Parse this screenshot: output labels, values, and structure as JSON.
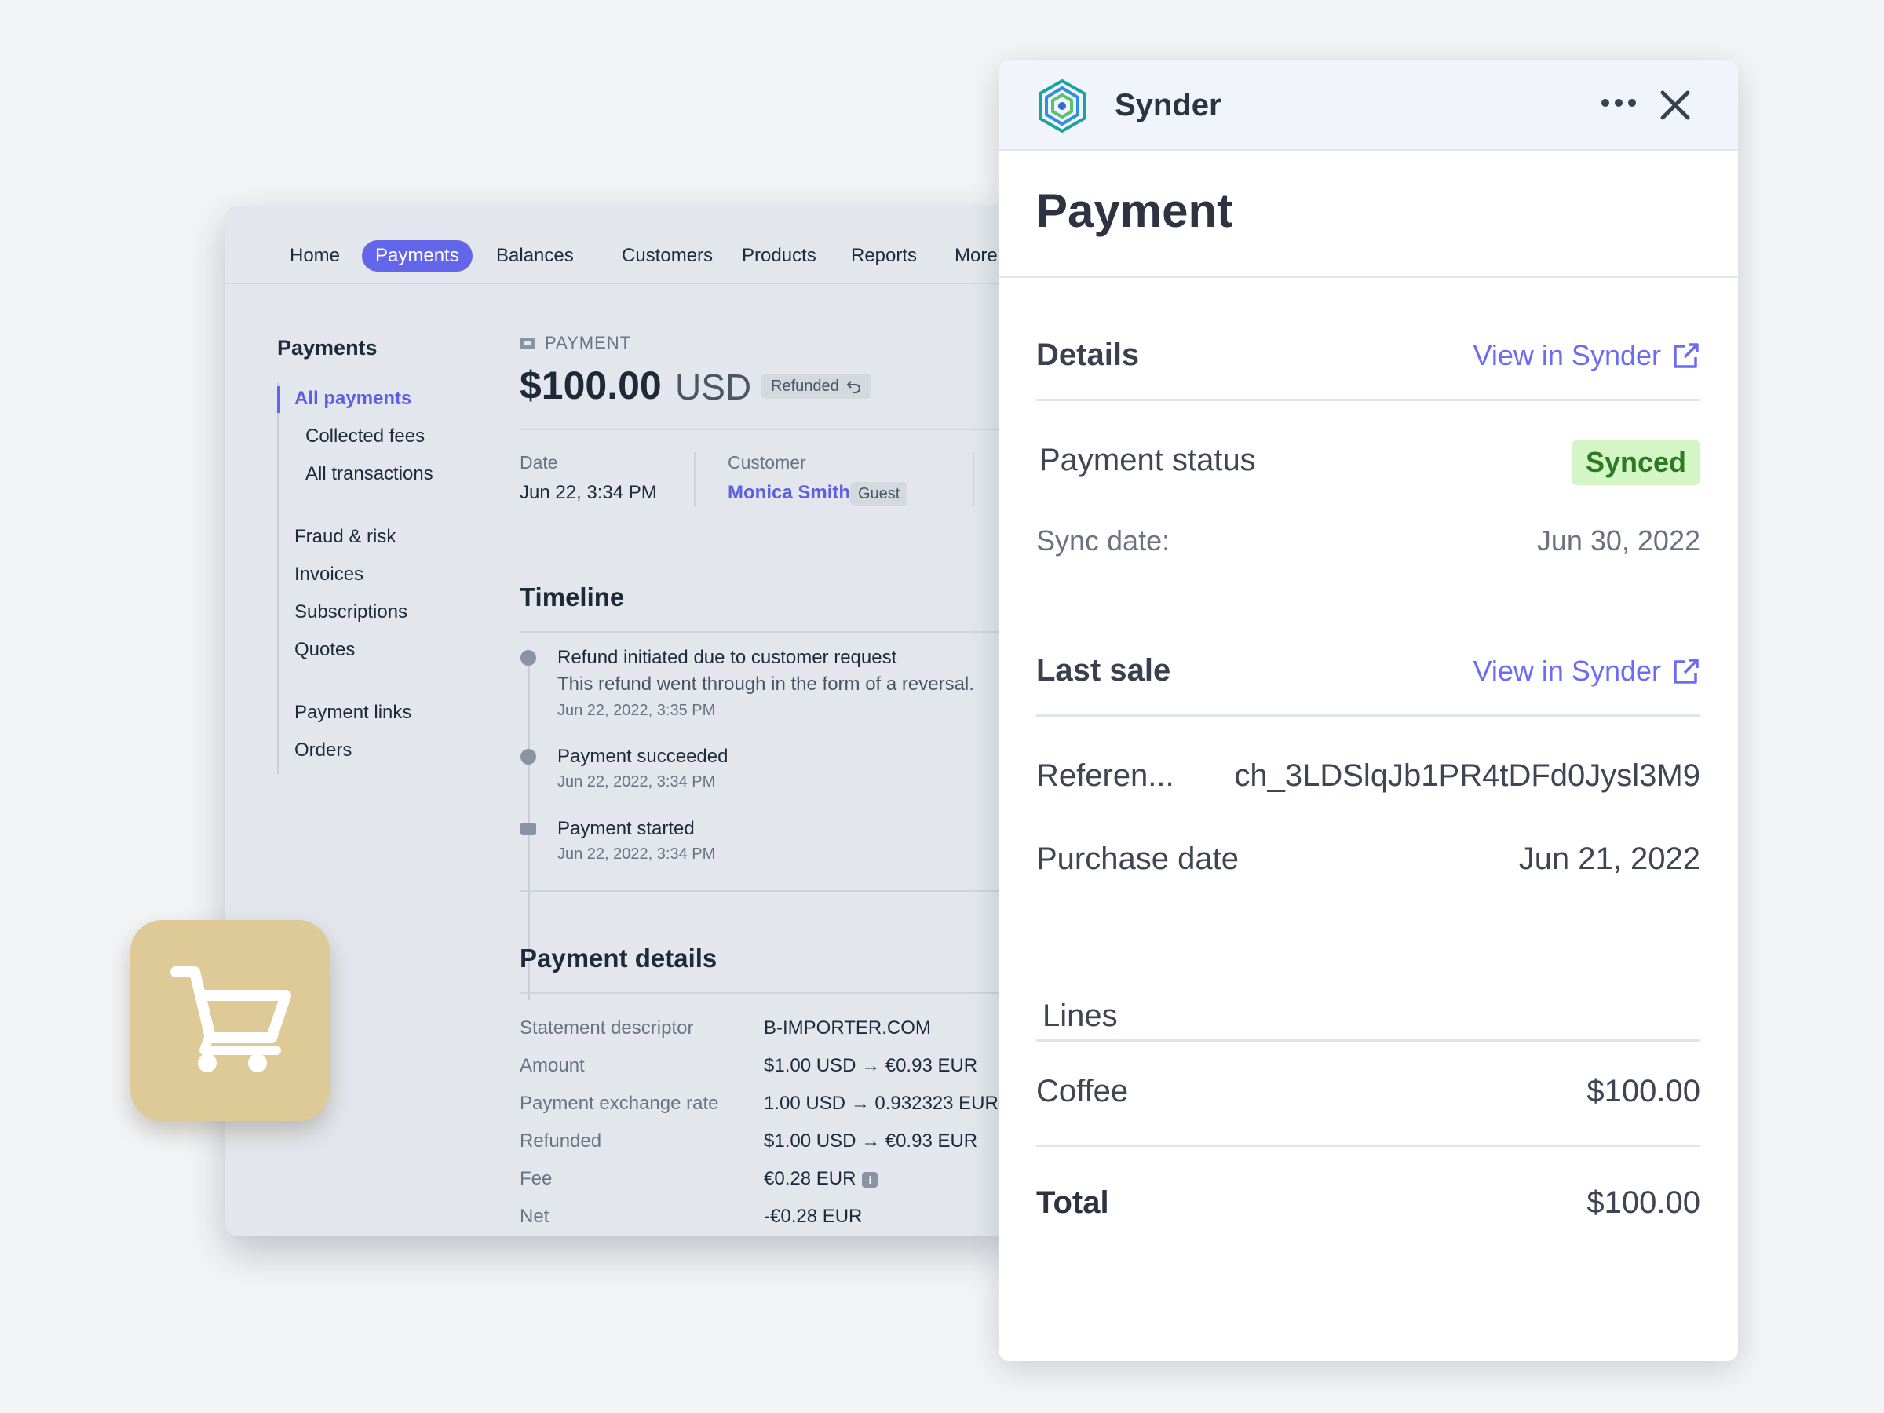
{
  "dashboard": {
    "nav": [
      "Home",
      "Payments",
      "Balances",
      "Customers",
      "Products",
      "Reports",
      "More"
    ],
    "nav_active": "Payments",
    "sidebar": {
      "title": "Payments",
      "items": [
        "All payments",
        "Collected fees",
        "All transactions",
        "Fraud & risk",
        "Invoices",
        "Subscriptions",
        "Quotes",
        "Payment links",
        "Orders"
      ]
    },
    "payment": {
      "label": "PAYMENT",
      "amount": "$100.00",
      "currency": "USD",
      "status_badge": "Refunded",
      "date_label": "Date",
      "date_value": "Jun 22, 3:34 PM",
      "customer_label": "Customer",
      "customer_name": "Monica Smith",
      "customer_badge": "Guest"
    },
    "timeline": {
      "title": "Timeline",
      "events": [
        {
          "title": "Refund initiated due to customer request",
          "subtitle": "This refund went through in the form of a reversal.",
          "time": "Jun 22, 2022, 3:35 PM"
        },
        {
          "title": "Payment succeeded",
          "time": "Jun 22, 2022, 3:34 PM"
        },
        {
          "title": "Payment started",
          "time": "Jun 22, 2022, 3:34 PM"
        }
      ]
    },
    "details": {
      "title": "Payment details",
      "rows": [
        {
          "label": "Statement descriptor",
          "value": "B-IMPORTER.COM"
        },
        {
          "label": "Amount",
          "value": "$1.00 USD  →  €0.93 EUR"
        },
        {
          "label": "Payment exchange rate",
          "value": "1.00 USD  →  0.932323 EUR"
        },
        {
          "label": "Refunded",
          "value": "$1.00 USD  →  €0.93 EUR"
        },
        {
          "label": "Fee",
          "value": "€0.28 EUR"
        },
        {
          "label": "Net",
          "value": "-€0.28 EUR"
        }
      ]
    }
  },
  "synder": {
    "brand": "Synder",
    "title": "Payment",
    "details": {
      "heading": "Details",
      "link": "View in Synder",
      "status_label": "Payment status",
      "status_value": "Synced",
      "sync_label": "Sync date:",
      "sync_value": "Jun 30, 2022"
    },
    "last_sale": {
      "heading": "Last sale",
      "link": "View in Synder",
      "reference_label": "Referen...",
      "reference_value": "ch_3LDSlqJb1PR4tDFd0Jysl3M9",
      "purchase_label": "Purchase date",
      "purchase_value": "Jun 21, 2022"
    },
    "lines": {
      "heading": "Lines",
      "items": [
        {
          "name": "Coffee",
          "amount": "$100.00"
        }
      ],
      "total_label": "Total",
      "total_value": "$100.00"
    },
    "colors": {
      "accent": "#6b6cf3",
      "synced_bg": "#d4f5c6",
      "synced_text": "#2c7a22"
    }
  },
  "cart_tile": {
    "icon": "shopping-cart-icon",
    "color": "#ddca96"
  }
}
